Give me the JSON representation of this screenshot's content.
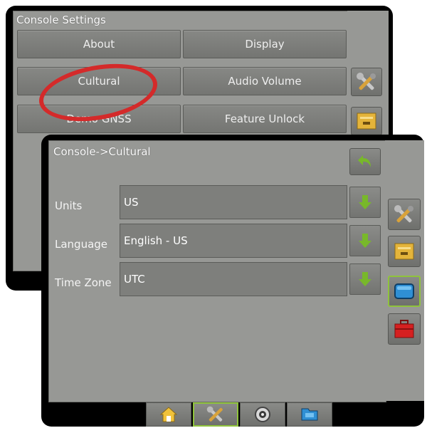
{
  "console_settings": {
    "title": "Console Settings",
    "buttons": {
      "about": "About",
      "display": "Display",
      "cultural": "Cultural",
      "audio_volume": "Audio Volume",
      "demo_gnss": "Demo GNSS",
      "feature_unlock": "Feature Unlock"
    }
  },
  "cultural": {
    "title": "Console->Cultural",
    "fields": {
      "units": {
        "label": "Units",
        "value": "US"
      },
      "language": {
        "label": "Language",
        "value": "English - US"
      },
      "time_zone": {
        "label": "Time Zone",
        "value": "UTC"
      }
    }
  },
  "icons": {
    "back": "back-arrow-icon",
    "tools": "tools-icon",
    "console": "console-icon",
    "display": "display-icon",
    "toolbox": "toolbox-icon",
    "home": "home-icon",
    "gnss": "gnss-icon",
    "data": "data-icon",
    "dropdown": "down-arrow-icon"
  },
  "colors": {
    "active_border": "#8fc33c",
    "arrow_green": "#78b82a",
    "highlight": "#d42a2a"
  }
}
